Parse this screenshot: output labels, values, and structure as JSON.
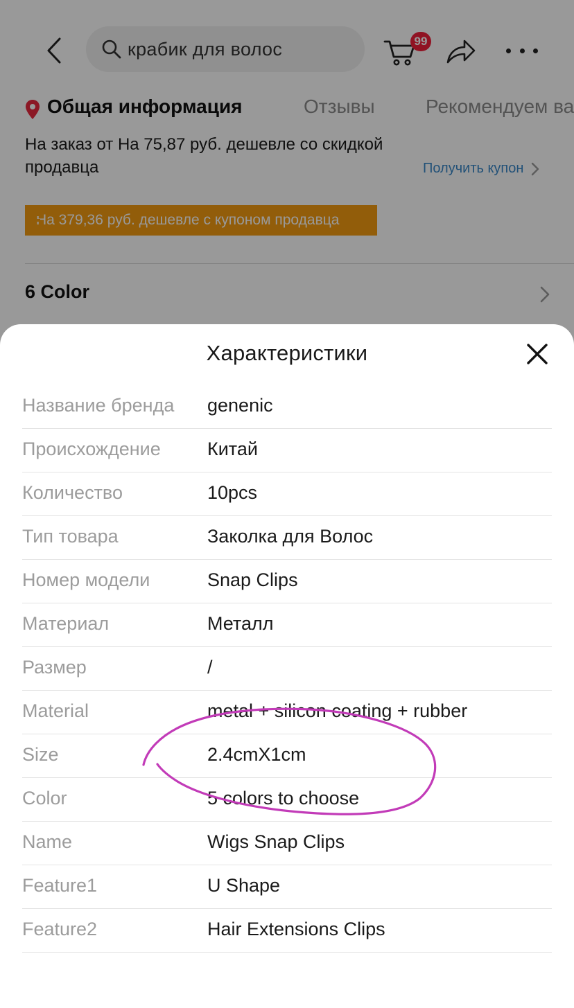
{
  "header": {
    "search_text": "крабик для волос",
    "cart_badge": "99"
  },
  "tabs": [
    {
      "label": "Общая информация",
      "active": true
    },
    {
      "label": "Отзывы",
      "active": false
    },
    {
      "label": "Рекомендуем ва",
      "active": false
    }
  ],
  "discount_text": "На заказ от На 75,87 руб. дешевле со скидкой продавца",
  "coupon_link": "Получить купон",
  "coupon_banner": "На 379,36 руб. дешевле с купоном продавца",
  "color_option": "6 Color",
  "sheet": {
    "title": "Характеристики",
    "specs": [
      {
        "label": "Название бренда",
        "value": "genenic"
      },
      {
        "label": "Происхождение",
        "value": "Китай"
      },
      {
        "label": "Количество",
        "value": "10pcs"
      },
      {
        "label": "Тип товара",
        "value": "Заколка для Волос"
      },
      {
        "label": "Номер модели",
        "value": "Snap Clips"
      },
      {
        "label": "Материал",
        "value": "Металл"
      },
      {
        "label": "Размер",
        "value": "/"
      },
      {
        "label": "Material",
        "value": "metal + silicon coating + rubber"
      },
      {
        "label": "Size",
        "value": "2.4cmX1cm"
      },
      {
        "label": "Color",
        "value": "5 colors to choose"
      },
      {
        "label": "Name",
        "value": "Wigs Snap Clips"
      },
      {
        "label": "Feature1",
        "value": "U Shape"
      },
      {
        "label": "Feature2",
        "value": "Hair Extensions Clips"
      }
    ]
  },
  "colors": {
    "accent_red": "#f0213b",
    "coupon_orange": "#f39c12",
    "link_blue": "#3a88c8",
    "annotation_magenta": "#c23bb8"
  },
  "icons": [
    "back-icon",
    "search-icon",
    "cart-icon",
    "share-icon",
    "more-icon",
    "location-pin-icon",
    "chevron-right-icon",
    "close-icon"
  ]
}
